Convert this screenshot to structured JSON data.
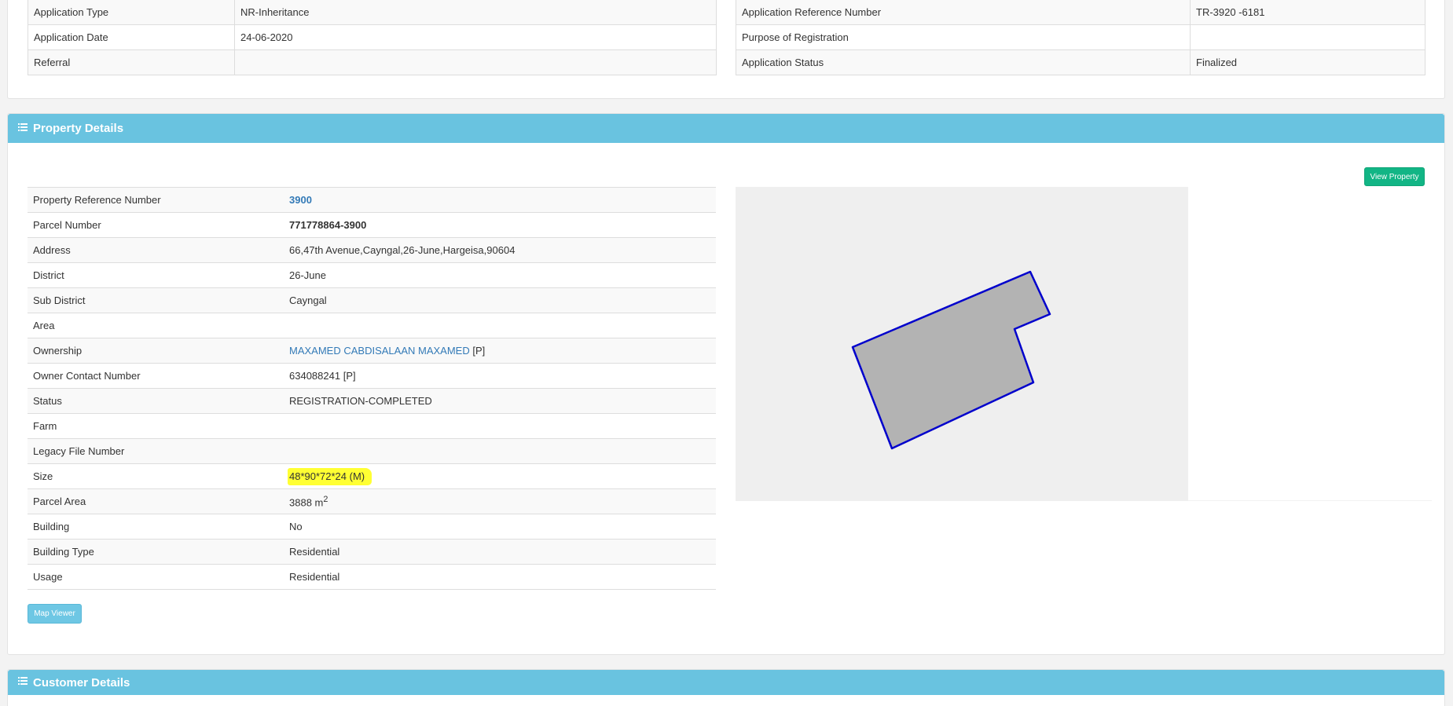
{
  "application": {
    "left_rows": [
      {
        "label": "Application Type",
        "value": "NR-Inheritance"
      },
      {
        "label": "Application Date",
        "value": "24-06-2020"
      },
      {
        "label": "Referral",
        "value": ""
      }
    ],
    "right_rows": [
      {
        "label": "Application Reference Number",
        "value": "TR-3920 -6181"
      },
      {
        "label": "Purpose of Registration",
        "value": ""
      },
      {
        "label": "Application Status",
        "value": "Finalized"
      }
    ]
  },
  "property": {
    "heading": "Property Details",
    "view_property_label": "View Property",
    "map_viewer_label": "Map Viewer",
    "rows": {
      "reference_number": {
        "label": "Property Reference Number",
        "value": "3900"
      },
      "parcel_number": {
        "label": "Parcel Number",
        "value": "771778864-3900"
      },
      "address": {
        "label": "Address",
        "value": "66,47th Avenue,Cayngal,26-June,Hargeisa,90604"
      },
      "district": {
        "label": "District",
        "value": "26-June"
      },
      "sub_district": {
        "label": "Sub District",
        "value": "Cayngal"
      },
      "area": {
        "label": "Area",
        "value": ""
      },
      "ownership": {
        "label": "Ownership",
        "value": "MAXAMED CABDISALAAN MAXAMED",
        "suffix": "[P]"
      },
      "owner_contact": {
        "label": "Owner Contact Number",
        "value": "634088241",
        "suffix": "[P]"
      },
      "status": {
        "label": "Status",
        "value": "REGISTRATION-COMPLETED"
      },
      "farm": {
        "label": "Farm",
        "value": ""
      },
      "legacy_file": {
        "label": "Legacy File Number",
        "value": ""
      },
      "size": {
        "label": "Size",
        "value": "48*90*72*24 (M)"
      },
      "parcel_area": {
        "label": "Parcel Area",
        "value": "3888 m",
        "unit_sup": "2"
      },
      "building": {
        "label": "Building",
        "value": "No"
      },
      "building_type": {
        "label": "Building Type",
        "value": "Residential"
      },
      "usage": {
        "label": "Usage",
        "value": "Residential"
      }
    }
  },
  "customer": {
    "heading": "Customer Details"
  },
  "icons": {
    "heading_icon": "list-icon"
  },
  "colors": {
    "heading_bg": "#69c3e0",
    "view_property_btn": "#12b585",
    "map_viewer_btn": "#6ec7e4",
    "parcel_fill": "#b3b3b3",
    "parcel_stroke": "#0000cc",
    "link": "#337ab7",
    "highlight": "#ffff33"
  }
}
